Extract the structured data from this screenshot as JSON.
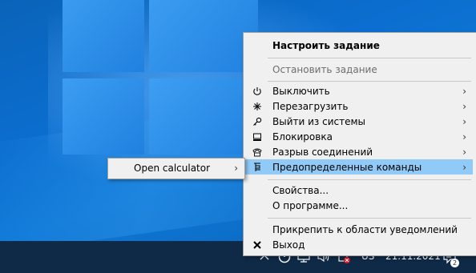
{
  "menu": {
    "items": [
      {
        "label": "Настроить задание"
      },
      {
        "label": "Остановить задание"
      },
      {
        "label": "Выключить"
      },
      {
        "label": "Перезагрузить"
      },
      {
        "label": "Выйти из системы"
      },
      {
        "label": "Блокировка"
      },
      {
        "label": "Разрыв соединений"
      },
      {
        "label": "Предопределенные команды"
      },
      {
        "label": "Свойства..."
      },
      {
        "label": "О программе..."
      },
      {
        "label": "Прикрепить к области уведомлений"
      },
      {
        "label": "Выход"
      }
    ],
    "submenu_arrow": "›"
  },
  "submenu": {
    "items": [
      {
        "label": "Open calculator"
      }
    ]
  },
  "taskbar": {
    "language": "US",
    "date": "21.11.2021",
    "notification_count": "2"
  },
  "icons": [
    "power-icon",
    "restart-icon",
    "key-icon",
    "lock-icon",
    "phone-icon",
    "commands-icon",
    "close-icon",
    "chevron-up-icon",
    "task-timer-icon",
    "network-icon",
    "volume-icon",
    "tray-app-icon",
    "notification-icon"
  ],
  "colors": {
    "menu_highlight": "#91c9f7",
    "menu_bg": "#f0f0f0",
    "taskbar": "#0f2a47",
    "desktop": "#0b6ed0"
  }
}
